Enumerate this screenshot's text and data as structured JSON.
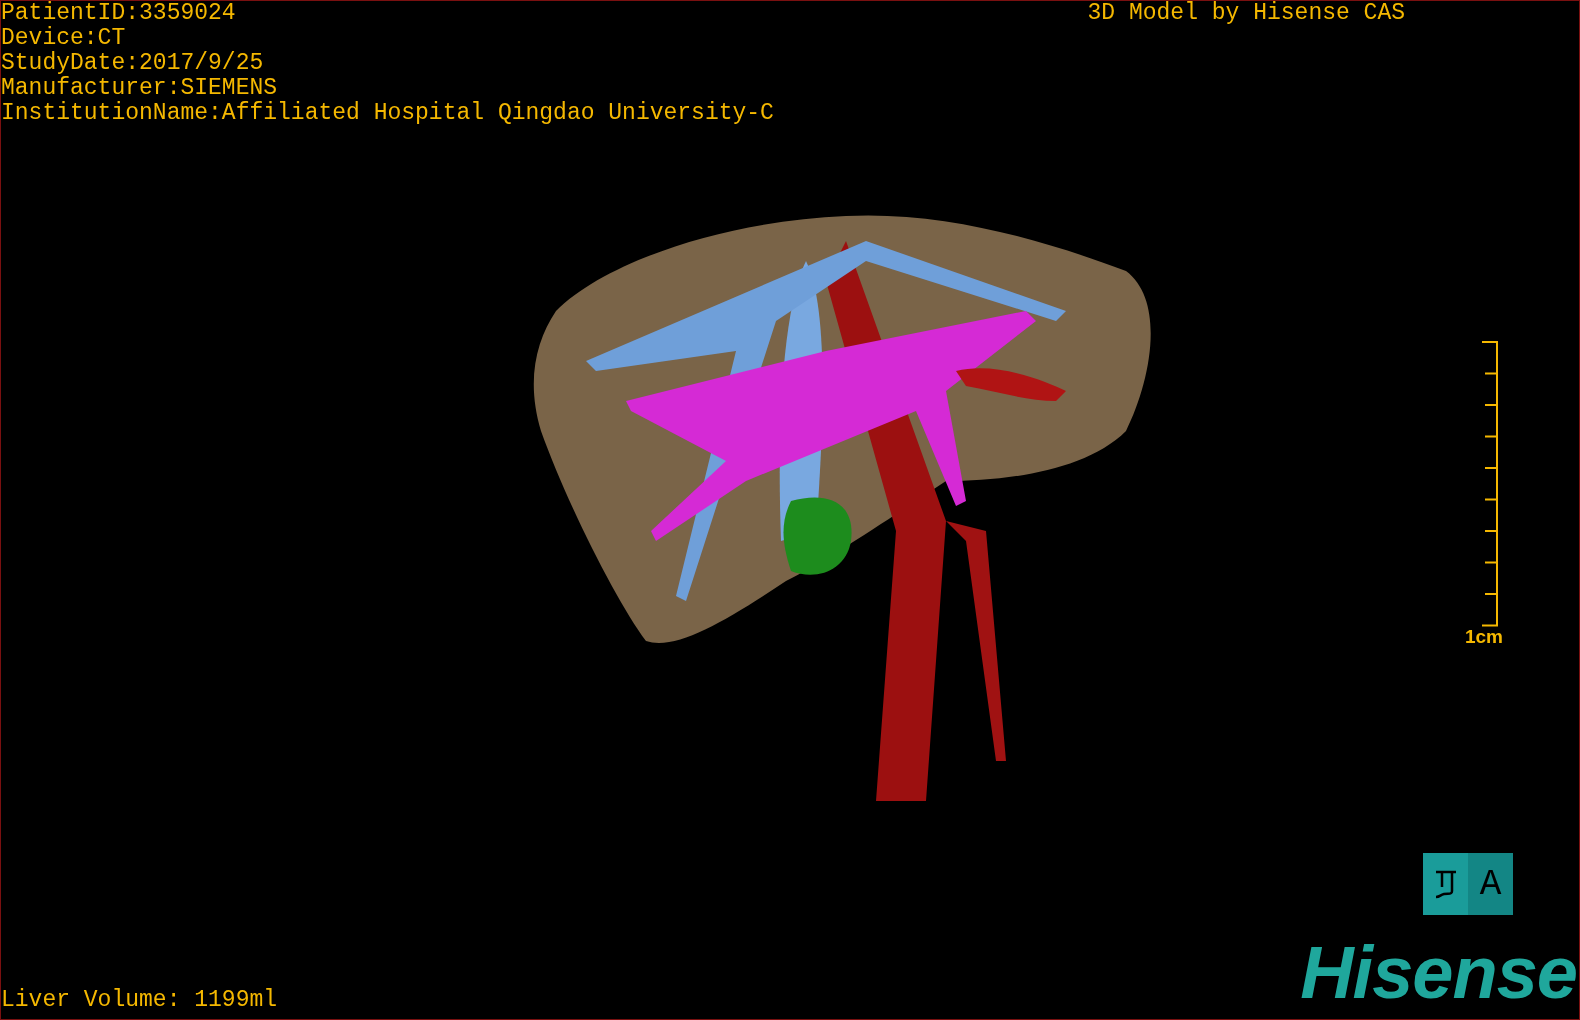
{
  "patient_info": [
    "PatientID:3359024",
    "Device:CT",
    "StudyDate:2017/9/25",
    "Manufacturer:SIEMENS",
    "InstitutionName:Affiliated Hospital Qingdao University-C"
  ],
  "title": "3D Model by Hisense CAS",
  "scale": {
    "label": "1cm"
  },
  "view_buttons": [
    {
      "kind": "icon"
    },
    {
      "kind": "letter",
      "label": "A"
    }
  ],
  "liver_volume": "Liver Volume: 1199ml",
  "logo": "Hisense"
}
